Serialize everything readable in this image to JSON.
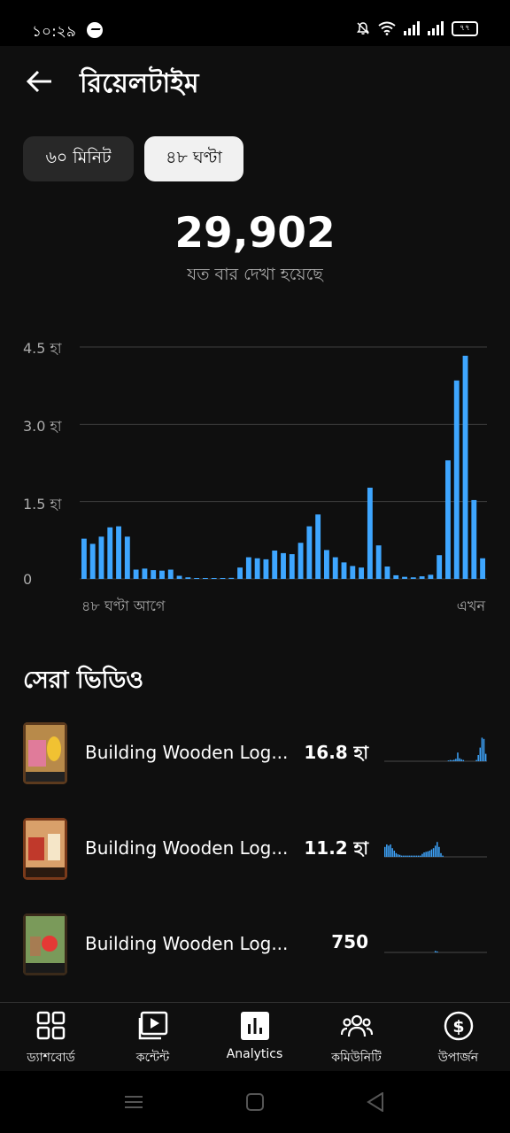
{
  "status": {
    "time": "১০:২৯",
    "battery": "৭৭"
  },
  "header": {
    "title": "রিয়েলটাইম"
  },
  "chips": [
    "৬০ মিনিট",
    "৪৮ ঘণ্টা"
  ],
  "selected_chip": "৪৮ ঘণ্টা",
  "summary": {
    "views": "29,902",
    "caption": "যত বার দেখা হয়েছে"
  },
  "chart_data": {
    "type": "bar",
    "y_ticks": [
      "4.5 হা",
      "3.0 হা",
      "1.5 হা",
      "0"
    ],
    "ylim": [
      0,
      4.5
    ],
    "x_start_label": "৪৮ ঘণ্টা আগে",
    "x_end_label": "এখন",
    "values": [
      0.78,
      0.68,
      0.82,
      1.0,
      1.02,
      0.82,
      0.18,
      0.2,
      0.17,
      0.16,
      0.18,
      0.06,
      0.03,
      0.01,
      0.01,
      0.01,
      0.01,
      0.02,
      0.22,
      0.42,
      0.4,
      0.38,
      0.55,
      0.5,
      0.48,
      0.7,
      1.02,
      1.25,
      0.56,
      0.42,
      0.32,
      0.25,
      0.22,
      1.77,
      0.65,
      0.24,
      0.07,
      0.04,
      0.03,
      0.05,
      0.08,
      0.46,
      2.3,
      3.85,
      4.33,
      1.53,
      0.4
    ],
    "color": "#3ea6ff",
    "grid": true
  },
  "top_videos": {
    "title": "সেরা ভিডিও",
    "items": [
      {
        "title": "Building Wooden Log...",
        "views": "16.8 হা",
        "spark": [
          0,
          0,
          0,
          0,
          0,
          0,
          0,
          0,
          0,
          0,
          0,
          0,
          0,
          0,
          0,
          0,
          0,
          0,
          0,
          0,
          0,
          0,
          0,
          0,
          0,
          0,
          0,
          0,
          0,
          0,
          0,
          0,
          0,
          0,
          0.03,
          0.05,
          0.04,
          0.06,
          0.1,
          0.35,
          0.12,
          0.08,
          0.05,
          0,
          0,
          0,
          0,
          0,
          0,
          0.05,
          0.25,
          0.55,
          0.95,
          0.9,
          0.3
        ]
      },
      {
        "title": "Building Wooden Log...",
        "views": "11.2 হা",
        "spark": [
          0.4,
          0.5,
          0.45,
          0.5,
          0.35,
          0.25,
          0.15,
          0.1,
          0.08,
          0.05,
          0.05,
          0.05,
          0.05,
          0.05,
          0.05,
          0.05,
          0.05,
          0.05,
          0.05,
          0.05,
          0.12,
          0.18,
          0.2,
          0.22,
          0.25,
          0.3,
          0.35,
          0.45,
          0.6,
          0.4,
          0.15,
          0.05,
          0,
          0,
          0,
          0,
          0,
          0,
          0,
          0,
          0,
          0,
          0,
          0,
          0,
          0,
          0,
          0,
          0,
          0,
          0,
          0,
          0,
          0,
          0
        ]
      },
      {
        "title": "Building Wooden Log...",
        "views": "750",
        "spark": [
          0,
          0,
          0,
          0,
          0,
          0,
          0,
          0,
          0,
          0,
          0,
          0,
          0,
          0,
          0,
          0,
          0,
          0,
          0,
          0,
          0,
          0,
          0,
          0,
          0,
          0,
          0,
          0.06,
          0.04,
          0,
          0,
          0,
          0,
          0,
          0,
          0,
          0,
          0,
          0,
          0,
          0,
          0,
          0,
          0,
          0,
          0,
          0,
          0,
          0,
          0,
          0,
          0,
          0,
          0,
          0
        ]
      }
    ]
  },
  "bottom_nav": [
    {
      "label": "ড্যাশবোর্ড",
      "icon": "dashboard-icon"
    },
    {
      "label": "কন্টেন্ট",
      "icon": "content-icon"
    },
    {
      "label": "Analytics",
      "icon": "analytics-icon"
    },
    {
      "label": "কমিউনিটি",
      "icon": "community-icon"
    },
    {
      "label": "উপার্জন",
      "icon": "earn-icon"
    }
  ],
  "colors": {
    "accent": "#3ea6ff",
    "background": "#0f0f0f"
  }
}
